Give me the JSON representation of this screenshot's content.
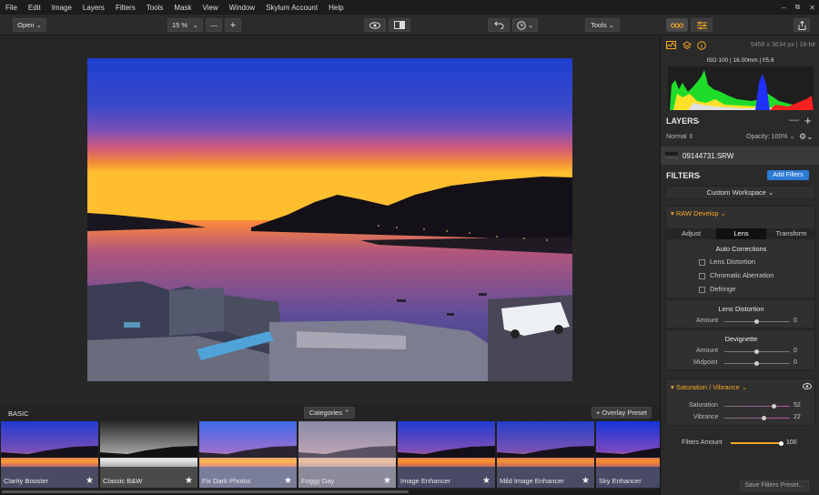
{
  "menu": [
    "File",
    "Edit",
    "Image",
    "Layers",
    "Filters",
    "Tools",
    "Mask",
    "View",
    "Window",
    "Skylum Account",
    "Help"
  ],
  "window_controls": {
    "minimize": "–",
    "restore": "⧉",
    "close": "✕"
  },
  "toolbar": {
    "open_label": "Open",
    "zoom_value": "15 %",
    "zoom_out": "—",
    "zoom_in": "+",
    "tools_label": "Tools"
  },
  "histogram": {
    "dimensions": "5456 x 3634 px",
    "bit_depth": "16-bit",
    "exif": "ISO 100 | 16.00mm | f/5.6"
  },
  "layers": {
    "title": "LAYERS",
    "blend_mode": "Normal",
    "opacity": "Opacity: 100%",
    "file_name": "09144731.SRW"
  },
  "filters": {
    "title": "FILTERS",
    "add_button": "Add Filters",
    "workspace": "Custom Workspace",
    "raw_develop": "RAW Develop",
    "tabs": [
      "Adjust",
      "Lens",
      "Transform"
    ],
    "active_tab": "Lens",
    "auto_corrections": {
      "title": "Auto Corrections",
      "options": [
        "Lens Distortion",
        "Chromatic Aberration",
        "Defringe"
      ]
    },
    "lens_distortion": {
      "title": "Lens Distortion",
      "amount_label": "Amount",
      "amount_value": "0"
    },
    "devignette": {
      "title": "Devignette",
      "amount_label": "Amount",
      "amount_value": "0",
      "midpoint_label": "Midpoint",
      "midpoint_value": "0"
    },
    "saturation_vibrance": {
      "title": "Saturation / Vibrance",
      "saturation_label": "Saturation",
      "saturation_value": "52",
      "vibrance_label": "Vibrance",
      "vibrance_value": "22"
    },
    "filters_amount_label": "Filters Amount",
    "filters_amount_value": "100",
    "save_button": "Save Filters Preset..."
  },
  "preset_bar": {
    "category": "BASIC",
    "categories_label": "Categories",
    "overlay_label": "+ Overlay Preset"
  },
  "presets": [
    "Clarity Booster",
    "Classic B&W",
    "Fix Dark Photos",
    "Foggy Day",
    "Image Enhancer",
    "Mild Image Enhancer",
    "Sky Enhancer"
  ],
  "colors": {
    "accent": "#f5a623",
    "add_button": "#2c7ad6",
    "panel_bg": "#2a2a2a"
  },
  "levels": {
    "filters_amount": 1.0,
    "saturation": 0.76,
    "vibrance": 0.61
  }
}
